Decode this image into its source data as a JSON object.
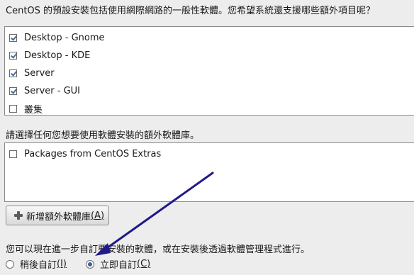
{
  "question": "CentOS 的預設安裝包括使用網際網路的一般性軟體。您希望系統還支援哪些額外項目呢？",
  "repo_groups": [
    {
      "label": "Desktop - Gnome",
      "checked": true
    },
    {
      "label": "Desktop - KDE",
      "checked": true
    },
    {
      "label": "Server",
      "checked": true
    },
    {
      "label": "Server - GUI",
      "checked": true
    },
    {
      "label": "叢集",
      "checked": false
    }
  ],
  "extra_repo_prompt": "請選擇任何您想要使用軟體安裝的額外軟體庫。",
  "extra_repos": [
    {
      "label": "Packages from CentOS Extras",
      "checked": false
    }
  ],
  "add_repo_button": {
    "label": "新增額外軟體庫",
    "mnemonic": "(A)"
  },
  "customize_note": "您可以現在進一步自訂要安裝的軟體，或在安裝後透過軟體管理程式進行。",
  "radio_options": [
    {
      "label": "稍後自訂",
      "mnemonic": "(I)",
      "selected": false
    },
    {
      "label": "立即自訂",
      "mnemonic": "(C)",
      "selected": true
    }
  ],
  "annotation_arrow_color": "#1f1a8a"
}
